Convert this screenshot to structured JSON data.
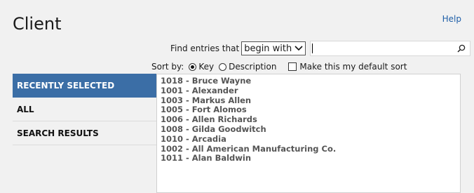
{
  "page": {
    "title": "Client",
    "help_label": "Help"
  },
  "find": {
    "label": "Find entries that",
    "mode_selected": "begin with",
    "query_value": ""
  },
  "sort": {
    "label": "Sort by:",
    "options": [
      {
        "label": "Key",
        "selected": true
      },
      {
        "label": "Description",
        "selected": false
      }
    ],
    "default_sort_label": "Make this my default sort",
    "default_sort_checked": false
  },
  "sidebar": {
    "items": [
      {
        "label": "RECENTLY SELECTED",
        "active": true
      },
      {
        "label": "ALL",
        "active": false
      },
      {
        "label": "SEARCH RESULTS",
        "active": false
      }
    ]
  },
  "entries": [
    "1018 - Bruce Wayne",
    "1001 - Alexander",
    "1003 - Markus Allen",
    "1005 - Fort Alomos",
    "1006 - Allen Richards",
    "1008 - Gilda Goodwitch",
    "1010 - Arcadia",
    "1002 - All American Manufacturing Co.",
    "1011 - Alan Baldwin"
  ],
  "colors": {
    "accent": "#3b6ea6",
    "link": "#1f5fa8"
  }
}
